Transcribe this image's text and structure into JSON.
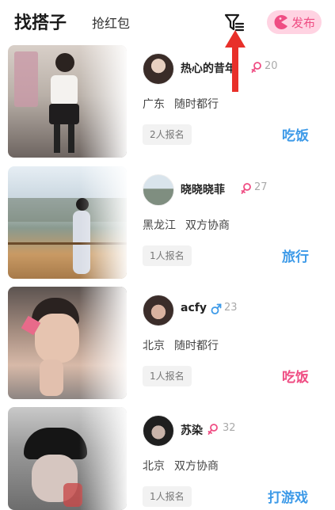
{
  "header": {
    "title": "找搭子",
    "tab_red_packet": "抢红包",
    "filter_icon": "filter-list-icon",
    "publish_label": "发布",
    "publish_icon": "pacman-icon"
  },
  "colors": {
    "accent_pink": "#ef4d83",
    "accent_blue": "#3d9ae8",
    "female": "#ef4d83",
    "male": "#3d9ae8"
  },
  "posts": [
    {
      "name": "热心的昔年",
      "gender": "female",
      "age": "20",
      "location": "广东",
      "availability": "随时都行",
      "signup": "2人报名",
      "activity": "吃饭",
      "activity_color": "#3d9ae8"
    },
    {
      "name": "晓晓晓菲",
      "gender": "female",
      "age": "27",
      "location": "黑龙江",
      "availability": "双方协商",
      "signup": "1人报名",
      "activity": "旅行",
      "activity_color": "#3d9ae8"
    },
    {
      "name": "acfy",
      "gender": "male",
      "age": "23",
      "location": "北京",
      "availability": "随时都行",
      "signup": "1人报名",
      "activity": "吃饭",
      "activity_color": "#ef4d83"
    },
    {
      "name": "苏染",
      "gender": "female",
      "age": "32",
      "location": "北京",
      "availability": "双方协商",
      "signup": "1人报名",
      "activity": "打游戏",
      "activity_color": "#3d9ae8"
    }
  ]
}
